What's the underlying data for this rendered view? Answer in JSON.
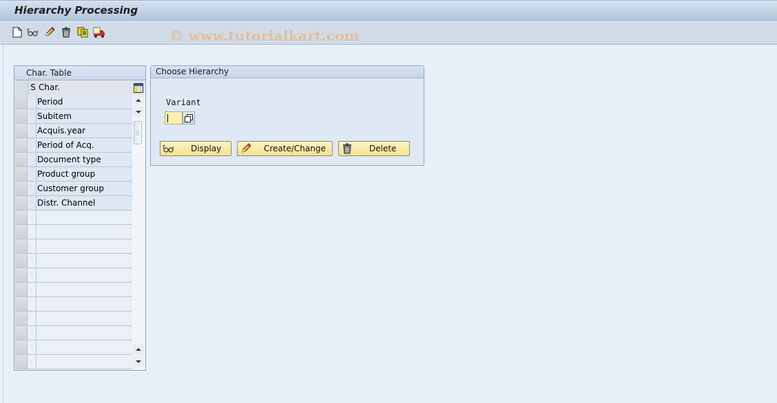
{
  "window": {
    "title": "Hierarchy Processing",
    "watermark": "© www.tutorialkart.com"
  },
  "toolbar": {
    "icons": [
      {
        "name": "new-document-icon",
        "tooltip": "Create"
      },
      {
        "name": "display-glasses-icon",
        "tooltip": "Display"
      },
      {
        "name": "pencil-edit-icon",
        "tooltip": "Change"
      },
      {
        "name": "trash-delete-icon",
        "tooltip": "Delete"
      },
      {
        "name": "copy-icon",
        "tooltip": "Copy"
      },
      {
        "name": "transport-truck-icon",
        "tooltip": "Transport"
      }
    ]
  },
  "char_table": {
    "title": "Char. Table",
    "columns": {
      "s": "S",
      "char": "Char."
    },
    "rows": [
      "Period",
      "Subitem",
      "Acquis.year",
      "Period of Acq.",
      "Document type",
      "Product group",
      "Customer group",
      "Distr. Channel",
      "",
      "",
      "",
      "",
      "",
      "",
      "",
      "",
      "",
      "",
      ""
    ]
  },
  "choose_hierarchy": {
    "title": "Choose Hierarchy",
    "variant_label": "Variant",
    "variant_value": "",
    "buttons": {
      "display": "Display",
      "create_change": "Create/Change",
      "delete": "Delete"
    }
  },
  "colors": {
    "input_bg": "#fcefb0",
    "button_bg": "#f5e08a",
    "title_gradient_top": "#d5e2ef",
    "page_bg": "#e8eff7"
  }
}
